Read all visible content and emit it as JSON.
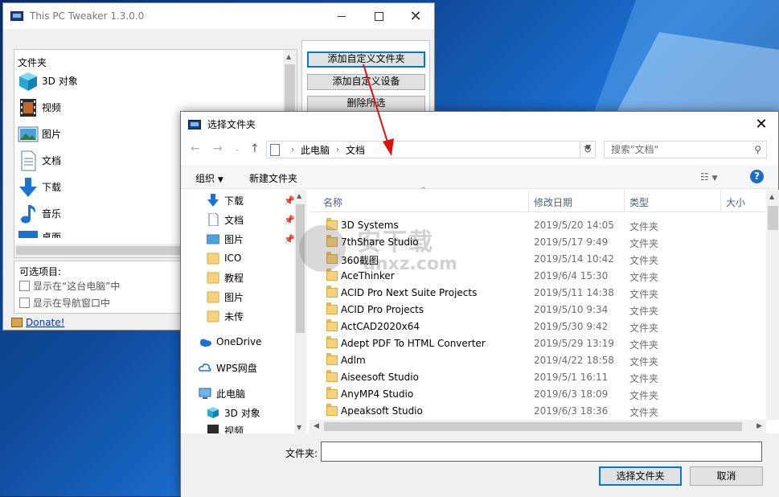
{
  "main_window": {
    "title": "This PC Tweaker 1.3.0.0",
    "folders_header": "文件夹",
    "folders": [
      {
        "label": "3D 对象",
        "icon": "3d-objects-icon"
      },
      {
        "label": "视频",
        "icon": "video-icon"
      },
      {
        "label": "图片",
        "icon": "pictures-icon"
      },
      {
        "label": "文档",
        "icon": "documents-icon"
      },
      {
        "label": "下载",
        "icon": "downloads-icon"
      },
      {
        "label": "音乐",
        "icon": "music-icon"
      },
      {
        "label": "桌面",
        "icon": "desktop-icon"
      }
    ],
    "buttons": {
      "add_custom_folder": "添加自定义文件夹",
      "add_custom_device": "添加自定义设备",
      "delete_selected": "删除所选"
    },
    "options_header": "可选项目:",
    "options": [
      {
        "label": "显示在“这台电脑”中",
        "checked": false
      },
      {
        "label": "显示在导航窗口中",
        "checked": false
      }
    ],
    "donate_link": "Donate!"
  },
  "dialog": {
    "title": "选择文件夹",
    "address": {
      "root": "此电脑",
      "current": "文档"
    },
    "search_placeholder": "搜索\"文档\"",
    "commands": {
      "organize": "组织",
      "new_folder": "新建文件夹"
    },
    "nav_items": [
      {
        "label": "下载",
        "icon": "downloads-icon",
        "pinned": true
      },
      {
        "label": "文档",
        "icon": "documents-icon",
        "pinned": true
      },
      {
        "label": "图片",
        "icon": "pictures-icon",
        "pinned": true
      },
      {
        "label": "ICO",
        "icon": "folder-icon",
        "pinned": false
      },
      {
        "label": "教程",
        "icon": "folder-icon",
        "pinned": false
      },
      {
        "label": "图片",
        "icon": "folder-icon",
        "pinned": false
      },
      {
        "label": "未传",
        "icon": "folder-icon",
        "pinned": false
      },
      {
        "label": "OneDrive",
        "icon": "onedrive-icon",
        "pinned": false
      },
      {
        "label": "WPS网盘",
        "icon": "wps-cloud-icon",
        "pinned": false
      },
      {
        "label": "此电脑",
        "icon": "this-pc-icon",
        "pinned": false
      },
      {
        "label": "3D 对象",
        "icon": "3d-objects-icon",
        "pinned": false
      },
      {
        "label": "视频",
        "icon": "video-icon",
        "pinned": false
      }
    ],
    "columns": {
      "name": "名称",
      "modified": "修改日期",
      "type": "类型",
      "size": "大小"
    },
    "files": [
      {
        "name": "3D Systems",
        "date": "2019/5/20 14:05",
        "type": "文件夹"
      },
      {
        "name": "7thShare Studio",
        "date": "2019/5/17 9:49",
        "type": "文件夹"
      },
      {
        "name": "360截图",
        "date": "2019/5/14 10:42",
        "type": "文件夹"
      },
      {
        "name": "AceThinker",
        "date": "2019/6/4 15:30",
        "type": "文件夹"
      },
      {
        "name": "ACID Pro Next Suite Projects",
        "date": "2019/5/11 14:38",
        "type": "文件夹"
      },
      {
        "name": "ACID Pro Projects",
        "date": "2019/5/10 9:34",
        "type": "文件夹"
      },
      {
        "name": "ActCAD2020x64",
        "date": "2019/5/30 9:42",
        "type": "文件夹"
      },
      {
        "name": "Adept PDF To HTML Converter",
        "date": "2019/5/29 13:19",
        "type": "文件夹"
      },
      {
        "name": "Adlm",
        "date": "2019/4/22 18:58",
        "type": "文件夹"
      },
      {
        "name": "Aiseesoft Studio",
        "date": "2019/5/1 16:11",
        "type": "文件夹"
      },
      {
        "name": "AnyMP4 Studio",
        "date": "2019/6/3 18:09",
        "type": "文件夹"
      },
      {
        "name": "Apeaksoft Studio",
        "date": "2019/6/3 18:36",
        "type": "文件夹"
      }
    ],
    "folder_label": "文件夹:",
    "folder_value": "",
    "select_button": "选择文件夹",
    "cancel_button": "取消"
  },
  "watermark": {
    "line1": "安下载",
    "line2": "anxz.com"
  },
  "colors": {
    "accent": "#0078d7",
    "annotation_arrow": "#e01010",
    "folder": "#f6d27a"
  }
}
